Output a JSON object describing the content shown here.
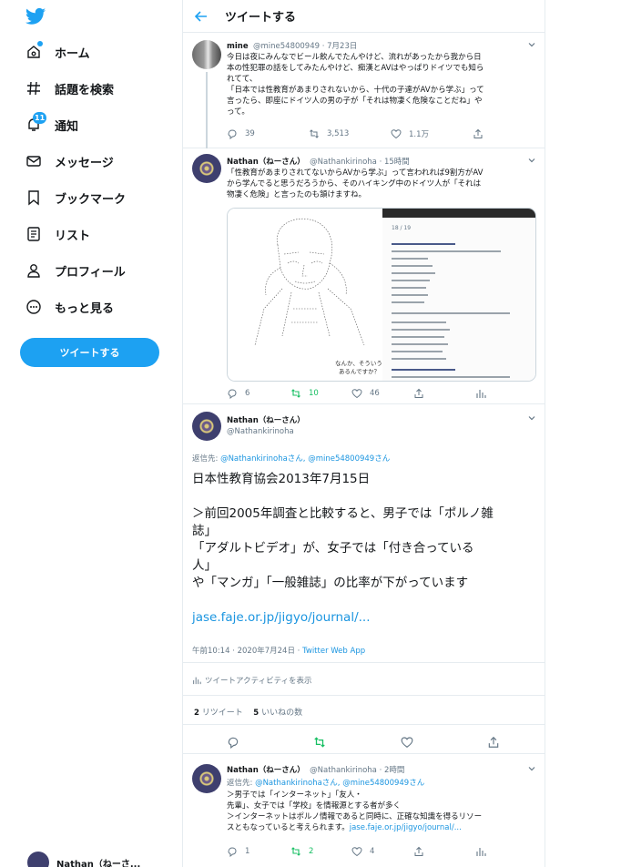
{
  "colors": {
    "accent": "#1da1f2",
    "retweet": "#17bf63",
    "muted": "#657786"
  },
  "sidebar": {
    "logo_icon": "twitter-bird-icon",
    "items": [
      {
        "label": "ホーム",
        "icon": "home-icon"
      },
      {
        "label": "話題を検索",
        "icon": "hashtag-icon"
      },
      {
        "label": "通知",
        "icon": "bell-icon",
        "badge": "11"
      },
      {
        "label": "メッセージ",
        "icon": "mail-icon"
      },
      {
        "label": "ブックマーク",
        "icon": "bookmark-icon"
      },
      {
        "label": "リスト",
        "icon": "list-icon"
      },
      {
        "label": "プロフィール",
        "icon": "person-icon"
      },
      {
        "label": "もっと見る",
        "icon": "more-circle-icon"
      }
    ],
    "tweet_button": "ツイートする",
    "account_name": "Nathan（ねーさ..."
  },
  "header": {
    "title": "ツイートする"
  },
  "tweets": [
    {
      "name": "mine",
      "handle": "@mine54800949 · 7月23日",
      "text": [
        "今日は夜にみんなでビール飲んでたんやけど、流れがあったから我から日",
        "本の性犯罪の話をしてみたんやけど、痴漢とAVはやっぱりドイツでも知ら",
        "れてて、",
        "「日本では性教育があまりされないから、十代の子達がAVから学ぶ」って",
        "言ったら、即座にドイツ人の男の子が「それは物凄く危険なことだね」や",
        "って。"
      ],
      "replies": "39",
      "retweets": "3,513",
      "likes": "1.1万"
    },
    {
      "name": "Nathan（ねーさん）",
      "handle": "@Nathankirinoha · 15時間",
      "text": [
        "「性教育があまりされてないからAVから学ぶ」って言われれば9割方がAV",
        "から学んでると思うだろうから、そのハイキング中のドイツ人が「それは",
        "物凄く危険」と言ったのも頷けますね。"
      ],
      "media_caption_1": "なんか、そういうデータ",
      "media_caption_2": "あるんですか？",
      "media_page": "18 / 19",
      "replies": "6",
      "retweets": "10",
      "likes": "46"
    },
    {
      "name": "Nathan（ねーさん）",
      "handle": "@Nathankirinoha",
      "reply_to_prefix": "返信先: ",
      "reply_to_users": "@Nathankirinohaさん, @mine54800949さん",
      "text": [
        "日本性教育協会2013年7月15日",
        "",
        "＞前回2005年調査と比較すると、男子では「ポルノ雑",
        "誌」",
        "「アダルトビデオ」が、女子では「付き合っている",
        "人」",
        "や「マンガ」「一般雑誌」の比率が下がっています",
        ""
      ],
      "link": "jase.faje.or.jp/jigyo/journal/...",
      "time_prefix": "午前10:14 · 2020年7月24日 · ",
      "source": "Twitter Web App",
      "activity": "ツイートアクティビティを表示",
      "retweet_count": "2",
      "retweet_label": "リツイート",
      "like_count": "5",
      "like_label": "いいねの数"
    },
    {
      "name": "Nathan（ねーさん）",
      "handle": "@Nathankirinoha · 2時間",
      "reply_to_prefix": "返信先: ",
      "reply_to_users": "@Nathankirinohaさん, @mine54800949さん",
      "text": [
        "＞男子では「インターネット」「友人・",
        "先輩」、女子では「学校」を情報源とする者が多く",
        "＞インターネットはポルノ情報であると同時に、正確な知識を得るリソー",
        "スともなっていると考えられます。"
      ],
      "link": "jase.faje.or.jp/jigyo/journal/...",
      "replies": "1",
      "retweets": "2",
      "likes": "4"
    }
  ]
}
